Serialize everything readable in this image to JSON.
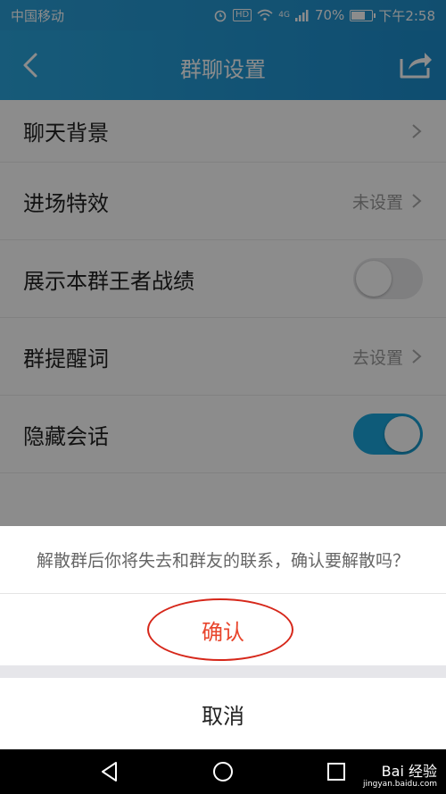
{
  "status_bar": {
    "carrier": "中国移动",
    "hd": "HD",
    "network": "4G",
    "battery": "70%",
    "battery_level": 0.7,
    "time": "下午2:58"
  },
  "nav": {
    "title": "群聊设置"
  },
  "settings": {
    "items": [
      {
        "label": "聊天背景",
        "value": ""
      },
      {
        "label": "进场特效",
        "value": "未设置"
      },
      {
        "label": "展示本群王者战绩",
        "toggle": false
      },
      {
        "label": "群提醒词",
        "value": "去设置"
      },
      {
        "label": "隐藏会话",
        "toggle": true
      }
    ]
  },
  "sheet": {
    "message": "解散群后你将失去和群友的联系，确认要解散吗？",
    "confirm_label": "确认",
    "cancel_label": "取消"
  },
  "watermark": {
    "brand": "Bai 经验",
    "url": "jingyan.baidu.com"
  },
  "colors": {
    "accent": "#1ba6dc",
    "danger": "#e8452c"
  }
}
